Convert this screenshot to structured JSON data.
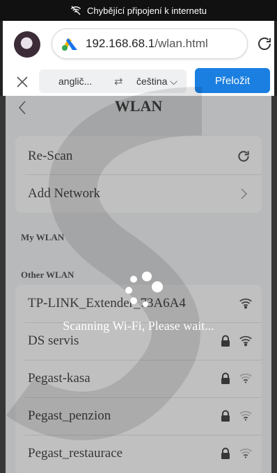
{
  "status_bar": {
    "text": "Chybějící připojení k internetu",
    "icon": "no-signal-icon"
  },
  "browser": {
    "url_host": "192.168.68.1",
    "url_path": "/wlan.html",
    "site_icon": "google-ads-icon",
    "reload_icon": "reload-icon"
  },
  "translate_bar": {
    "source_language": "anglič...",
    "target_language": "čeština",
    "translate_label": "Přeložit"
  },
  "page": {
    "title": "WLAN",
    "actions": [
      {
        "label": "Re-Scan",
        "icon": "refresh-icon"
      },
      {
        "label": "Add Network",
        "icon": "chevron-right-icon"
      }
    ],
    "my_wlan_label": "My WLAN",
    "other_wlan_label": "Other WLAN",
    "networks": [
      {
        "ssid": "TP-LINK_Extender_73A6A4",
        "locked": false,
        "signal": "strong"
      },
      {
        "ssid": "DS servis",
        "locked": true,
        "signal": "strong"
      },
      {
        "ssid": "Pegast-kasa",
        "locked": true,
        "signal": "weak"
      },
      {
        "ssid": "Pegast_penzion",
        "locked": true,
        "signal": "weak"
      },
      {
        "ssid": "Pegast_restaurace",
        "locked": true,
        "signal": "weak"
      }
    ]
  },
  "overlay": {
    "message": "Scanning Wi-Fi, Please wait..."
  },
  "colors": {
    "accent": "#1a7fe0",
    "status_bar": "#111111",
    "overlay": "#5a5a5a"
  }
}
